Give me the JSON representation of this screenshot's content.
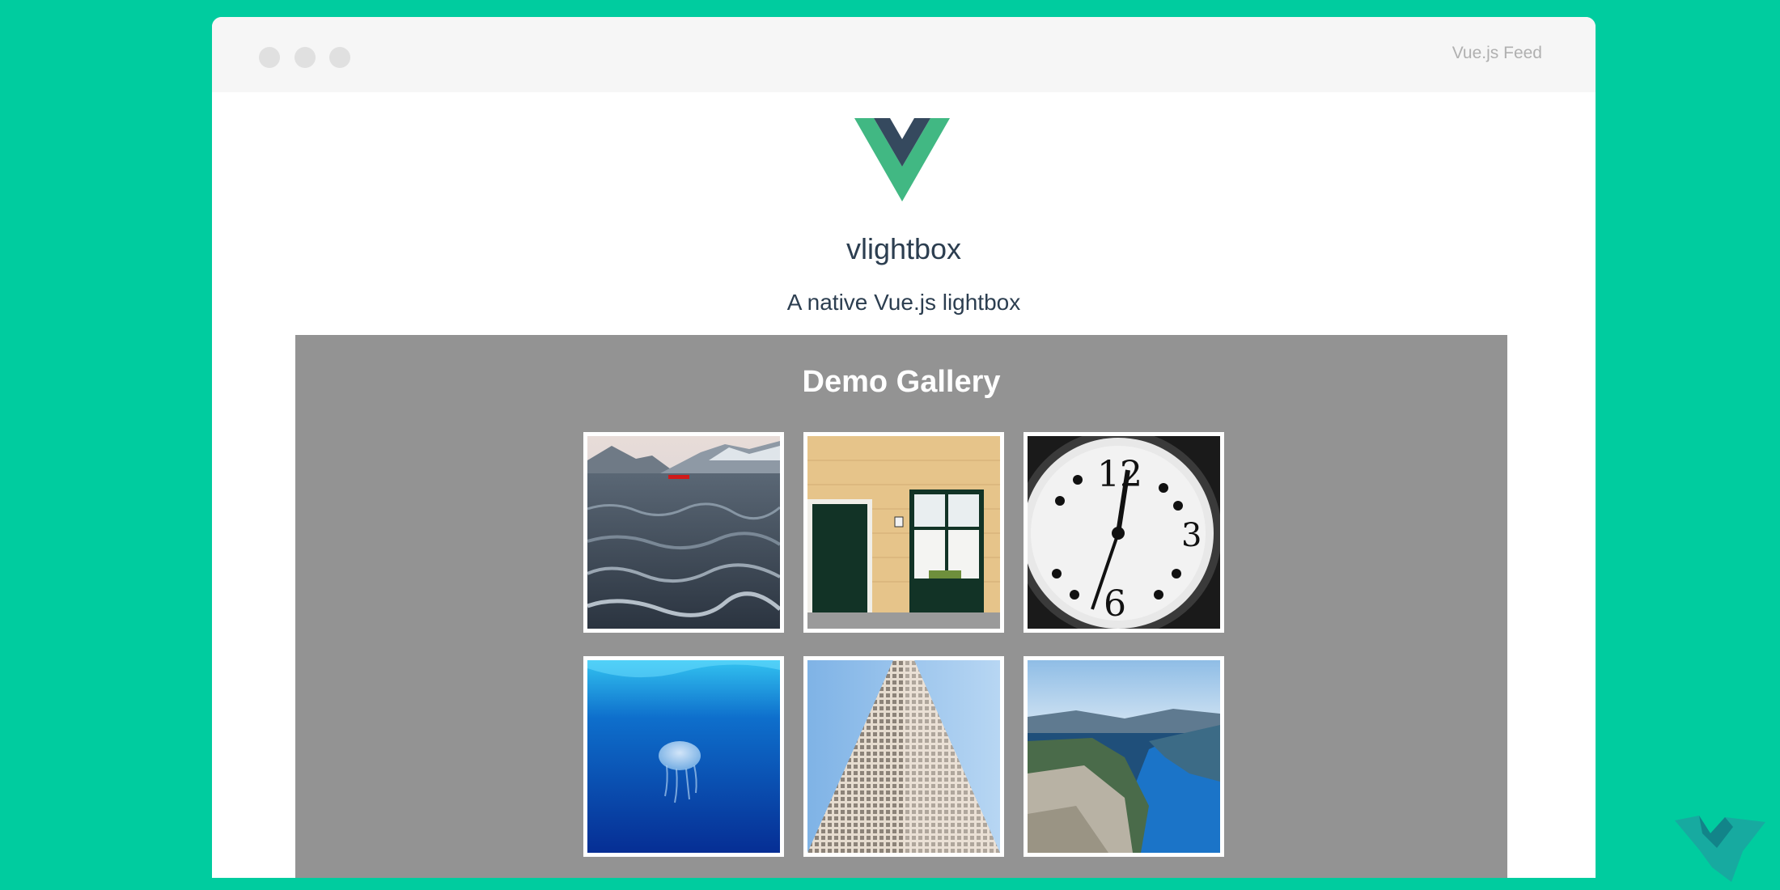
{
  "window": {
    "site_label": "Vue.js Feed"
  },
  "header": {
    "logo": "vue-logo-icon",
    "title": "vlightbox",
    "subtitle": "A native Vue.js lightbox"
  },
  "gallery": {
    "heading": "Demo Gallery",
    "images": [
      {
        "subject": "ocean-waves-mountains-image"
      },
      {
        "subject": "yellow-brick-house-door-image"
      },
      {
        "subject": "clock-face-image"
      },
      {
        "subject": "underwater-jellyfish-image"
      },
      {
        "subject": "skyscraper-looking-up-image"
      },
      {
        "subject": "fjord-cliff-landscape-image"
      }
    ]
  },
  "colors": {
    "background": "#00cc9f",
    "vue_green": "#41b883",
    "vue_dark": "#35495e",
    "gallery_bg": "#939393",
    "text": "#2c3e50"
  }
}
